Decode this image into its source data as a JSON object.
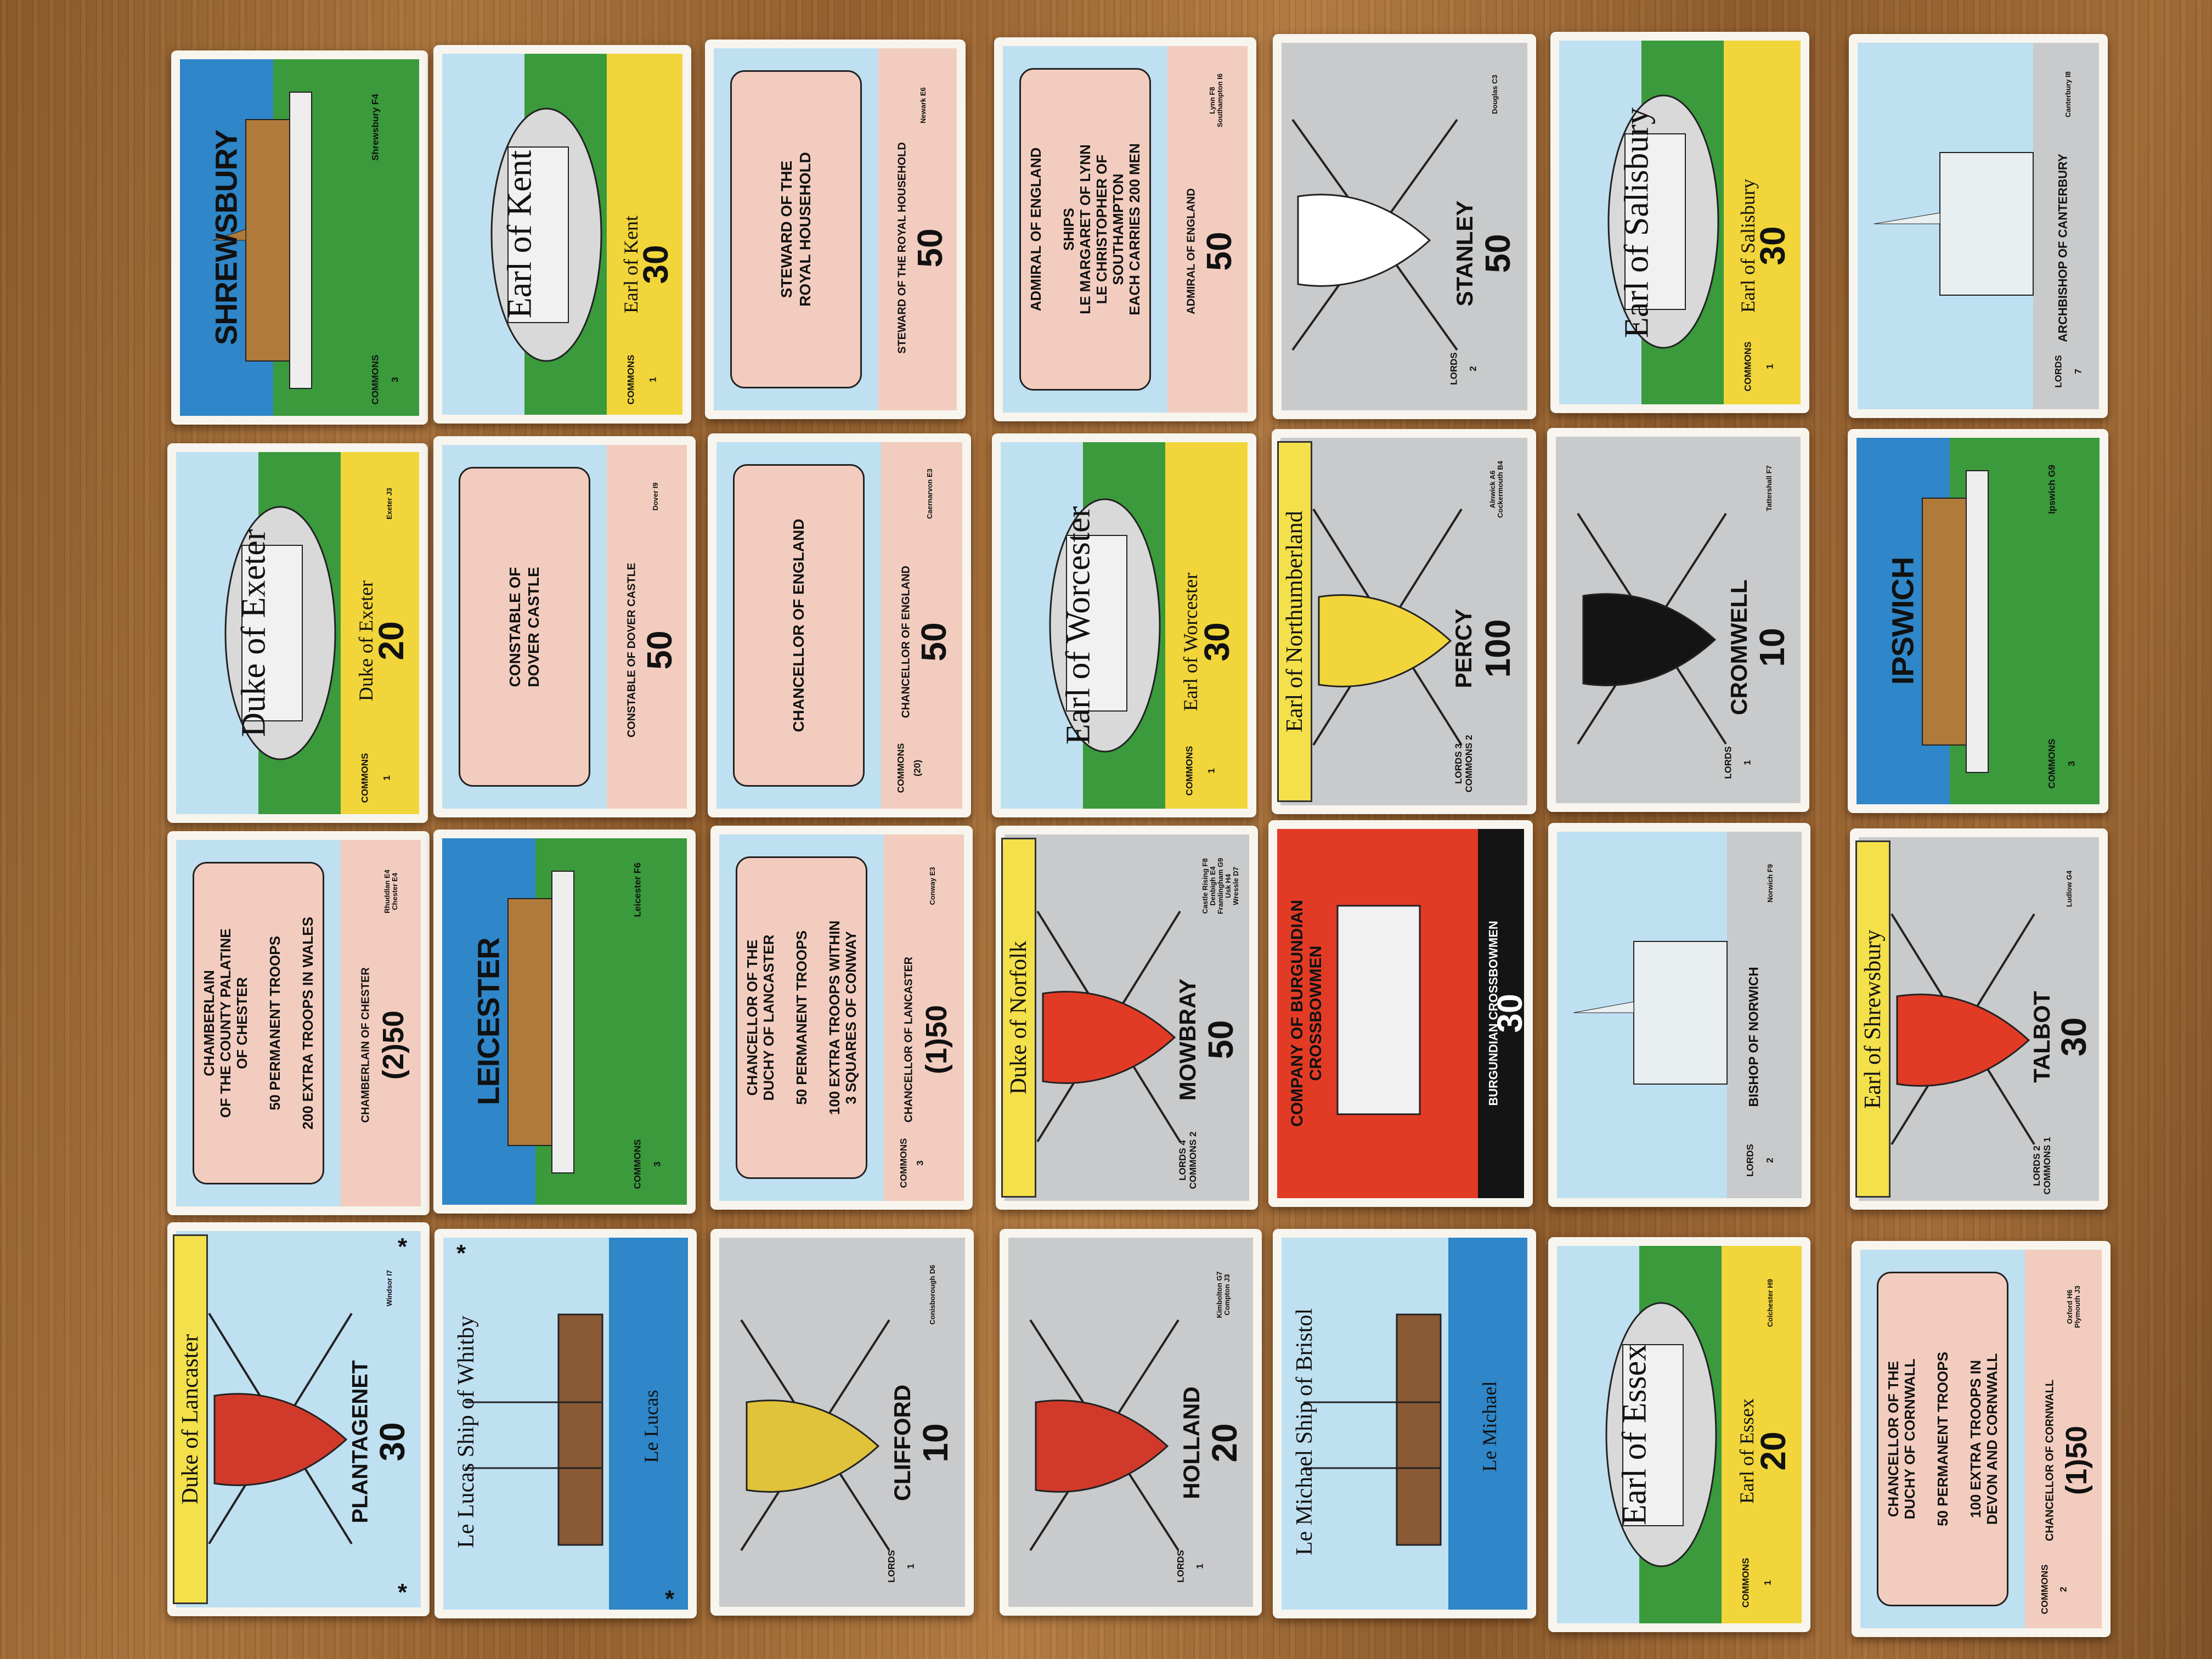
{
  "cards": [
    {
      "id": "shrewsbury",
      "title": "SHREWSBURY",
      "location": "Shrewsbury F4",
      "house": "COMMONS",
      "seats": "3"
    },
    {
      "id": "earl-of-kent",
      "title": "Earl of Kent",
      "band_title": "Earl of Kent",
      "value": "30",
      "house": "COMMONS",
      "seats": "1"
    },
    {
      "id": "steward",
      "scroll": "STEWARD OF THE\nROYAL HOUSEHOLD",
      "band_title": "STEWARD OF THE ROYAL HOUSEHOLD",
      "value": "50",
      "location": "Newark E6"
    },
    {
      "id": "admiral",
      "scroll": "ADMIRAL OF ENGLAND\n \nSHIPS\nLE MARGARET OF LYNN\nLE CHRISTOPHER OF\nSOUTHAMPTON\nEACH CARRIES 200 MEN",
      "band_title": "ADMIRAL OF ENGLAND",
      "value": "50",
      "location": "Lynn F8\nSouthampton I6"
    },
    {
      "id": "stanley",
      "name": "STANLEY",
      "value": "50",
      "location": "Douglas C3",
      "house": "LORDS",
      "seats": "2"
    },
    {
      "id": "earl-of-salisbury",
      "title": "Earl of Salisbury",
      "band_title": "Earl of Salisbury",
      "value": "30",
      "house": "COMMONS",
      "seats": "1"
    },
    {
      "id": "archbishop-canterbury",
      "name": "ARCHBISHOP OF CANTERBURY",
      "location": "Canterbury I8",
      "house": "LORDS",
      "seats": "7"
    },
    {
      "id": "duke-of-exeter",
      "title": "Duke of Exeter",
      "band_title": "Duke of Exeter",
      "value": "20",
      "location": "Exeter J3",
      "house": "COMMONS",
      "seats": "1"
    },
    {
      "id": "constable-dover",
      "scroll": "CONSTABLE OF\nDOVER CASTLE",
      "band_title": "CONSTABLE OF DOVER CASTLE",
      "value": "50",
      "location": "Dover I9"
    },
    {
      "id": "chancellor-england",
      "scroll": "CHANCELLOR OF ENGLAND",
      "band_title": "CHANCELLOR OF ENGLAND",
      "value": "50",
      "location": "Caernarvon E3",
      "house": "COMMONS",
      "seats": "(20)"
    },
    {
      "id": "earl-of-worcester",
      "title": "Earl of Worcester",
      "band_title": "Earl of Worcester",
      "value": "30",
      "house": "COMMONS",
      "seats": "1"
    },
    {
      "id": "percy",
      "banner": "Earl of Northumberland",
      "name": "PERCY",
      "value": "100",
      "location": "Alnwick A6\nCockermouth B4",
      "house": "LORDS 3\nCOMMONS 2"
    },
    {
      "id": "cromwell",
      "name": "CROMWELL",
      "value": "10",
      "location": "Tattershall F7",
      "house": "LORDS",
      "seats": "1"
    },
    {
      "id": "ipswich",
      "title": "IPSWICH",
      "location": "Ipswich G9",
      "house": "COMMONS",
      "seats": "3"
    },
    {
      "id": "chamberlain-chester",
      "scroll": "CHAMBERLAIN\nOF THE COUNTY PALATINE\nOF CHESTER\n \n50 PERMANENT TROOPS\n \n200 EXTRA TROOPS IN WALES",
      "band_title": "CHAMBERLAIN OF CHESTER",
      "value": "(2)50",
      "location": "Rhuddlan E4\nChester E4"
    },
    {
      "id": "leicester",
      "title": "LEICESTER",
      "location": "Leicester F6",
      "house": "COMMONS",
      "seats": "3"
    },
    {
      "id": "chancellor-lancaster",
      "scroll": "CHANCELLOR OF THE\nDUCHY OF LANCASTER\n \n50 PERMANENT TROOPS\n \n100 EXTRA TROOPS WITHIN\n3 SQUARES OF CONWAY",
      "band_title": "CHANCELLOR OF LANCASTER",
      "value": "(1)50",
      "location": "Conway E3",
      "house": "COMMONS",
      "seats": "3"
    },
    {
      "id": "mowbray",
      "banner": "Duke of Norfolk",
      "name": "MOWBRAY",
      "value": "50",
      "location": "Castle Rising F8\nDenbigh E4\nFramlingham G9\nUsk H4\nWressle D7",
      "house": "LORDS 4\nCOMMONS 2"
    },
    {
      "id": "burgundian",
      "title": "COMPANY OF BURGUNDIAN\nCROSSBOWMEN",
      "band_title": "BURGUNDIAN CROSSBOWMEN",
      "value": "30"
    },
    {
      "id": "bishop-norwich",
      "name": "BISHOP OF NORWICH",
      "location": "Norwich F9",
      "house": "LORDS",
      "seats": "2"
    },
    {
      "id": "talbot",
      "banner": "Earl of Shrewsbury",
      "name": "TALBOT",
      "value": "30",
      "location": "Ludlow G4",
      "house": "LORDS 2\nCOMMONS 1"
    },
    {
      "id": "plantagenet",
      "banner": "Duke of Lancaster",
      "name": "PLANTAGENET",
      "value": "30",
      "location": "Windsor I7",
      "star": "*"
    },
    {
      "id": "le-lucas",
      "title": "Le Lucas Ship of Whitby",
      "band_title": "Le Lucas",
      "star": "*"
    },
    {
      "id": "clifford",
      "name": "CLIFFORD",
      "value": "10",
      "location": "Conisborough D6",
      "house": "LORDS",
      "seats": "1"
    },
    {
      "id": "holland",
      "name": "HOLLAND",
      "value": "20",
      "location": "Kimbolton G7\nCompton J3",
      "house": "LORDS",
      "seats": "1"
    },
    {
      "id": "le-michael",
      "title": "Le Michael Ship of Bristol",
      "band_title": "Le Michael"
    },
    {
      "id": "earl-of-essex",
      "title": "Earl of Essex",
      "band_title": "Earl of Essex",
      "value": "20",
      "location": "Colchester H9",
      "house": "COMMONS",
      "seats": "1"
    },
    {
      "id": "chancellor-cornwall",
      "scroll": "CHANCELLOR OF THE\nDUCHY OF CORNWALL\n \n50 PERMANENT TROOPS\n \n100 EXTRA TROOPS IN\nDEVON AND CORNWALL",
      "band_title": "CHANCELLOR OF CORNWALL",
      "value": "(1)50",
      "location": "Oxford H6\nPlymouth J3",
      "house": "COMMONS",
      "seats": "2"
    }
  ],
  "colors": {
    "blue": "#2f86c8",
    "green": "#3a9a3c",
    "yellow": "#f1d53a",
    "pink": "#f2cdbf",
    "grey": "#c9cacb",
    "sky": "#bfe0f1",
    "red": "#e23b25",
    "black": "#141414"
  }
}
